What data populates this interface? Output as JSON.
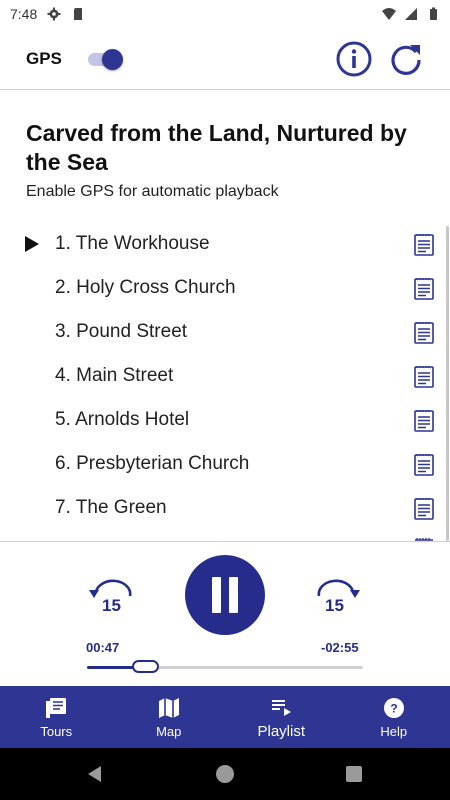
{
  "status_bar": {
    "time": "7:48",
    "icons": [
      "gear-icon",
      "sd-card-icon",
      "wifi-icon",
      "signal-icon",
      "battery-icon"
    ]
  },
  "header": {
    "gps_label": "GPS",
    "gps_enabled": true,
    "actions": [
      "info-icon",
      "refresh-icon"
    ]
  },
  "tour": {
    "title": "Carved from the Land, Nurtured by the Sea",
    "subtitle": "Enable GPS for automatic playback"
  },
  "playlist": {
    "current_index": 0,
    "items": [
      {
        "label": "1. The Workhouse"
      },
      {
        "label": "2. Holy Cross Church"
      },
      {
        "label": "3. Pound Street"
      },
      {
        "label": "4. Main Street"
      },
      {
        "label": "5. Arnolds Hotel"
      },
      {
        "label": "6. Presbyterian Church"
      },
      {
        "label": "7. The Green"
      }
    ]
  },
  "player": {
    "skip_back_seconds": "15",
    "skip_forward_seconds": "15",
    "elapsed": "00:47",
    "remaining": "-02:55",
    "progress_fraction": 0.213,
    "state": "playing"
  },
  "bottom_nav": {
    "items": [
      {
        "label": "Tours",
        "icon": "tours-icon"
      },
      {
        "label": "Map",
        "icon": "map-icon"
      },
      {
        "label": "Playlist",
        "icon": "playlist-icon",
        "active": true
      },
      {
        "label": "Help",
        "icon": "help-icon"
      }
    ]
  },
  "colors": {
    "primary": "#2e3592",
    "accent": "#262c8c",
    "toggle_track": "#c3c4e6"
  }
}
